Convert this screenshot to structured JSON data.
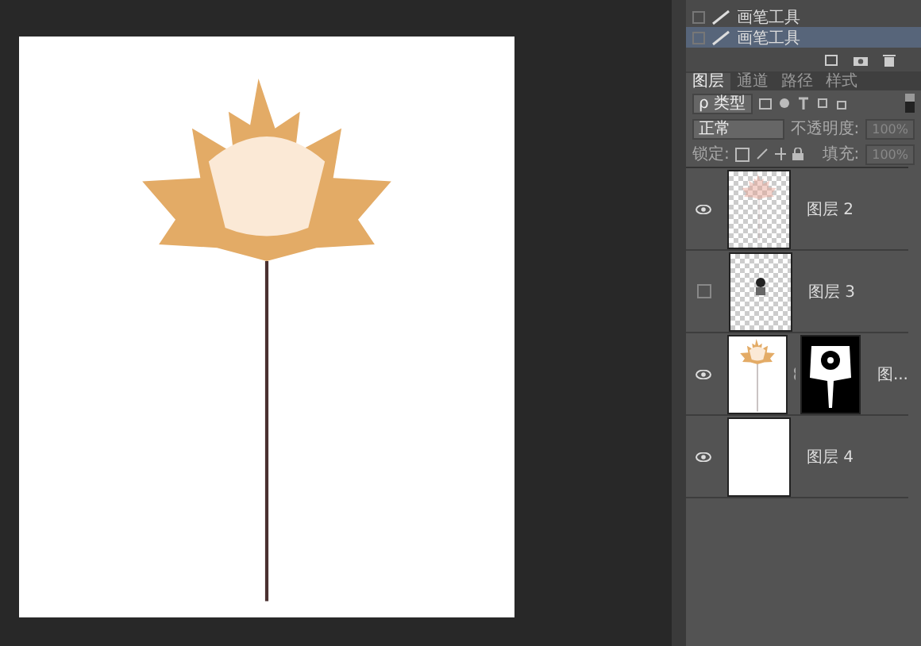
{
  "history": {
    "items": [
      {
        "label": "画笔工具",
        "selected": false
      },
      {
        "label": "画笔工具",
        "selected": true
      }
    ]
  },
  "layers_panel": {
    "tabs": [
      {
        "label": "图层",
        "selected": true
      },
      {
        "label": "通道",
        "selected": false
      },
      {
        "label": "路径",
        "selected": false
      },
      {
        "label": "样式",
        "selected": false
      }
    ],
    "filter": {
      "icon": "ρ",
      "value": "类型"
    },
    "blend_mode": "正常",
    "opacity_label": "不透明度:",
    "opacity": "100%",
    "lock_label": "锁定:",
    "fill_label": "填充:",
    "fill": "100%",
    "layers": [
      {
        "name": "图层 2",
        "visible": true,
        "kind": "faded",
        "mask": false
      },
      {
        "name": "图层 3",
        "visible": false,
        "kind": "figure",
        "mask": false
      },
      {
        "name": "图...",
        "visible": true,
        "kind": "leaf",
        "mask": true
      },
      {
        "name": "图层 4",
        "visible": true,
        "kind": "white",
        "mask": false
      }
    ]
  }
}
